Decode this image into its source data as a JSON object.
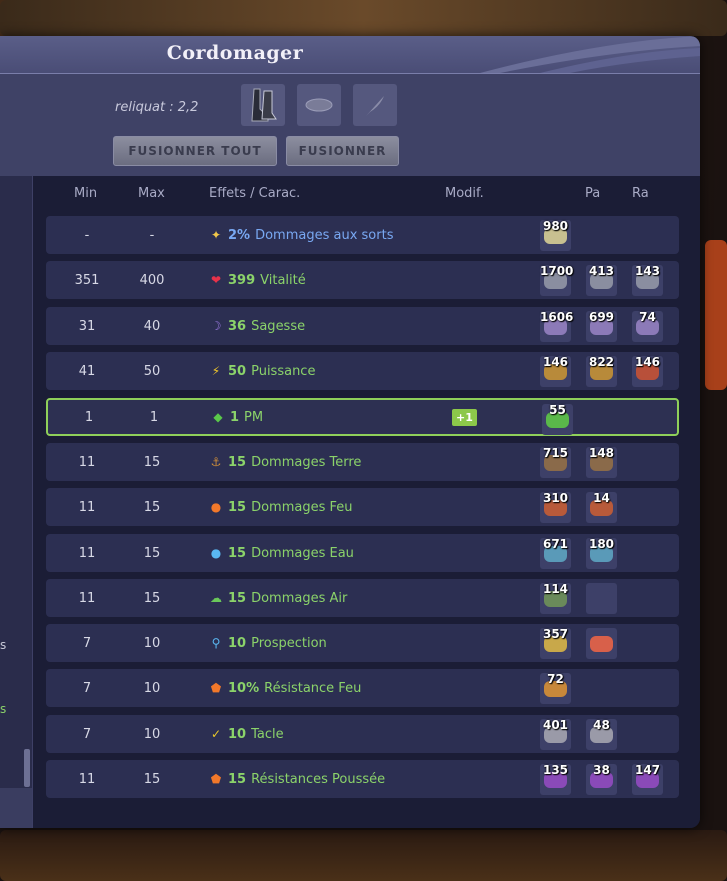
{
  "window": {
    "title": "Cordomager"
  },
  "top": {
    "reliquat": "reliquat : 2,2",
    "buttons": {
      "fusion_all": "FUSIONNER TOUT",
      "fusion": "FUSIONNER"
    }
  },
  "side": {
    "text1": "s",
    "text2": "s"
  },
  "table": {
    "headers": {
      "min": "Min",
      "max": "Max",
      "effects": "Effets / Carac.",
      "modif": "Modif.",
      "pa": "Pa",
      "ra": "Ra"
    },
    "rows": [
      {
        "min": "-",
        "max": "-",
        "icon": "star-icon",
        "value": "2%",
        "label": "Dommages aux sorts",
        "color": "#79a8f2",
        "modif": "",
        "runes": [
          "980"
        ],
        "rune_colors": [
          "#c8c090"
        ]
      },
      {
        "min": "351",
        "max": "400",
        "icon": "heart-icon",
        "value": "399",
        "label": "Vitalité",
        "color": "#8bd36a",
        "modif": "",
        "runes": [
          "1700",
          "413",
          "143"
        ],
        "rune_colors": [
          "#8a8ea0",
          "#8a8ea0",
          "#8a8ea0"
        ]
      },
      {
        "min": "31",
        "max": "40",
        "icon": "moon-icon",
        "value": "36",
        "label": "Sagesse",
        "color": "#8bd36a",
        "modif": "",
        "runes": [
          "1606",
          "699",
          "74"
        ],
        "rune_colors": [
          "#8c7ab8",
          "#8c7ab8",
          "#8c7ab8"
        ]
      },
      {
        "min": "41",
        "max": "50",
        "icon": "lightning-icon",
        "value": "50",
        "label": "Puissance",
        "color": "#8bd36a",
        "modif": "",
        "runes": [
          "146",
          "822",
          "146"
        ],
        "rune_colors": [
          "#b88a3a",
          "#b88a3a",
          "#b8503a"
        ]
      },
      {
        "min": "1",
        "max": "1",
        "icon": "diamond-icon",
        "value": "1",
        "label": "PM",
        "color": "#8bd36a",
        "modif": "+1",
        "runes": [
          "55"
        ],
        "rune_colors": [
          "#5ab84a"
        ]
      },
      {
        "min": "11",
        "max": "15",
        "icon": "earth-icon",
        "value": "15",
        "label": "Dommages Terre",
        "color": "#8bd36a",
        "modif": "",
        "runes": [
          "715",
          "148"
        ],
        "rune_colors": [
          "#8a6a4a",
          "#8a6a4a"
        ]
      },
      {
        "min": "11",
        "max": "15",
        "icon": "fire-icon",
        "value": "15",
        "label": "Dommages Feu",
        "color": "#8bd36a",
        "modif": "",
        "runes": [
          "310",
          "14"
        ],
        "rune_colors": [
          "#b85a3a",
          "#b85a3a"
        ]
      },
      {
        "min": "11",
        "max": "15",
        "icon": "water-drop-icon",
        "value": "15",
        "label": "Dommages Eau",
        "color": "#8bd36a",
        "modif": "",
        "runes": [
          "671",
          "180"
        ],
        "rune_colors": [
          "#5a9ab8",
          "#5a9ab8"
        ]
      },
      {
        "min": "11",
        "max": "15",
        "icon": "air-icon",
        "value": "15",
        "label": "Dommages Air",
        "color": "#8bd36a",
        "modif": "",
        "runes": [
          "114",
          ""
        ],
        "rune_colors": [
          "#6a8a5a",
          "#3d4068"
        ]
      },
      {
        "min": "7",
        "max": "10",
        "icon": "magnifier-icon",
        "value": "10",
        "label": "Prospection",
        "color": "#8bd36a",
        "modif": "",
        "runes": [
          "357",
          ""
        ],
        "rune_colors": [
          "#c8a84a",
          "#d8604a"
        ]
      },
      {
        "min": "7",
        "max": "10",
        "icon": "shield-fire-icon",
        "value": "10%",
        "label": "Résistance Feu",
        "color": "#8bd36a",
        "modif": "",
        "runes": [
          "72"
        ],
        "rune_colors": [
          "#c8883a"
        ]
      },
      {
        "min": "7",
        "max": "10",
        "icon": "tackle-icon",
        "value": "10",
        "label": "Tacle",
        "color": "#8bd36a",
        "modif": "",
        "runes": [
          "401",
          "48"
        ],
        "rune_colors": [
          "#9a9aa8",
          "#9a9aa8"
        ]
      },
      {
        "min": "11",
        "max": "15",
        "icon": "shield-push-icon",
        "value": "15",
        "label": "Résistances Poussée",
        "color": "#8bd36a",
        "modif": "",
        "runes": [
          "135",
          "38",
          "147"
        ],
        "rune_colors": [
          "#8a4ab8",
          "#8a4ab8",
          "#8a4ab8"
        ]
      }
    ]
  }
}
